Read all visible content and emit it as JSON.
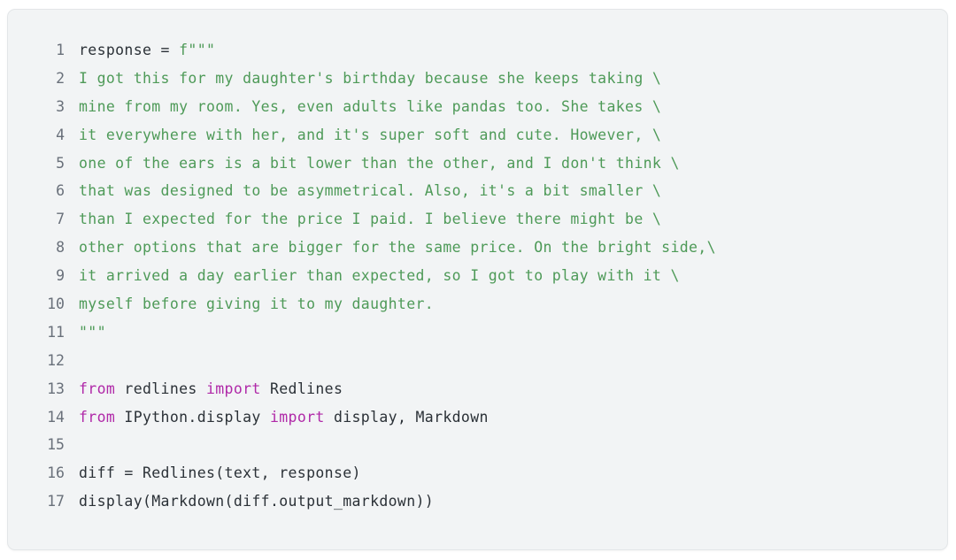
{
  "editor": {
    "name": "python-code-block",
    "language": "python",
    "background_color": "#f2f4f5",
    "border_color": "#e3e6e8",
    "page_background": "#ffffff",
    "colors": {
      "plain": "#2b3137",
      "string": "#4e9a58",
      "keyword": "#b029a8",
      "line_number": "#69707a"
    },
    "first_line_number": 1,
    "total_lines": 17,
    "lines": [
      {
        "number": "1",
        "tokens": [
          {
            "t": "response = ",
            "c": "pln"
          },
          {
            "t": "f\"\"\"",
            "c": "str"
          }
        ]
      },
      {
        "number": "2",
        "tokens": [
          {
            "t": "I got this for my daughter's birthday because she keeps taking \\",
            "c": "str"
          }
        ]
      },
      {
        "number": "3",
        "tokens": [
          {
            "t": "mine from my room. Yes, even adults like pandas too. She takes \\",
            "c": "str"
          }
        ]
      },
      {
        "number": "4",
        "tokens": [
          {
            "t": "it everywhere with her, and it's super soft and cute. However, \\",
            "c": "str"
          }
        ]
      },
      {
        "number": "5",
        "tokens": [
          {
            "t": "one of the ears is a bit lower than the other, and I don't think \\",
            "c": "str"
          }
        ]
      },
      {
        "number": "6",
        "tokens": [
          {
            "t": "that was designed to be asymmetrical. Also, it's a bit smaller \\",
            "c": "str"
          }
        ]
      },
      {
        "number": "7",
        "tokens": [
          {
            "t": "than I expected for the price I paid. I believe there might be \\",
            "c": "str"
          }
        ]
      },
      {
        "number": "8",
        "tokens": [
          {
            "t": "other options that are bigger for the same price. On the bright side,\\",
            "c": "str"
          }
        ]
      },
      {
        "number": "9",
        "tokens": [
          {
            "t": "it arrived a day earlier than expected, so I got to play with it \\",
            "c": "str"
          }
        ]
      },
      {
        "number": "10",
        "tokens": [
          {
            "t": "myself before giving it to my daughter.",
            "c": "str"
          }
        ]
      },
      {
        "number": "11",
        "tokens": [
          {
            "t": "\"\"\"",
            "c": "str"
          }
        ]
      },
      {
        "number": "12",
        "tokens": []
      },
      {
        "number": "13",
        "tokens": [
          {
            "t": "from",
            "c": "kw"
          },
          {
            "t": " redlines ",
            "c": "pln"
          },
          {
            "t": "import",
            "c": "kw"
          },
          {
            "t": " Redlines",
            "c": "pln"
          }
        ]
      },
      {
        "number": "14",
        "tokens": [
          {
            "t": "from",
            "c": "kw"
          },
          {
            "t": " IPython.display ",
            "c": "pln"
          },
          {
            "t": "import",
            "c": "kw"
          },
          {
            "t": " display, Markdown",
            "c": "pln"
          }
        ]
      },
      {
        "number": "15",
        "tokens": []
      },
      {
        "number": "16",
        "tokens": [
          {
            "t": "diff = Redlines(text, response)",
            "c": "pln"
          }
        ]
      },
      {
        "number": "17",
        "tokens": [
          {
            "t": "display(Markdown(diff.output_markdown))",
            "c": "pln"
          }
        ]
      }
    ]
  }
}
